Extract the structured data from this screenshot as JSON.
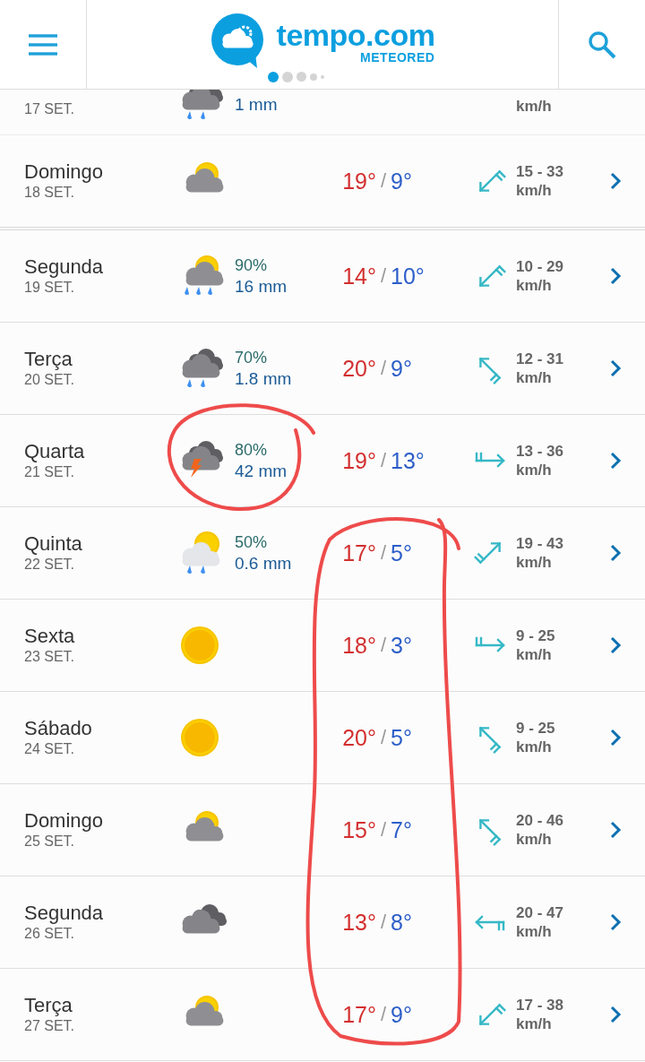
{
  "header": {
    "brand": "tempo.com",
    "sub_brand": "METEORED",
    "pager": [
      {
        "selected": true
      },
      {
        "selected": false
      },
      {
        "selected": false
      },
      {
        "selected": false
      },
      {
        "selected": false
      }
    ]
  },
  "partial_row": {
    "date": "17 SET.",
    "sky": {
      "kind": "cloudy-rain"
    },
    "precip_amount": "1 mm",
    "wind_unit": "km/h"
  },
  "days": [
    {
      "day": "Domingo",
      "date": "18 SET.",
      "sky": {
        "kind": "partly-cloudy"
      },
      "max": "19°",
      "separator": "/",
      "min": "9°",
      "wind_arrow": {
        "kind": "northeast"
      },
      "wind": "15 - 33",
      "wind_unit": "km/h"
    },
    {
      "day": "Segunda",
      "date": "19 SET.",
      "sky": {
        "kind": "partly-cloudy-rain"
      },
      "precip_chance": "90%",
      "precip_amount": "16 mm",
      "max": "14°",
      "separator": "/",
      "min": "10°",
      "wind_arrow": {
        "kind": "northeast"
      },
      "wind": "10 - 29",
      "wind_unit": "km/h"
    },
    {
      "day": "Terça",
      "date": "20 SET.",
      "sky": {
        "kind": "cloudy-rain"
      },
      "precip_chance": "70%",
      "precip_amount": "1.8 mm",
      "max": "20°",
      "separator": "/",
      "min": "9°",
      "wind_arrow": {
        "kind": "southeast"
      },
      "wind": "12 - 31",
      "wind_unit": "km/h"
    },
    {
      "day": "Quarta",
      "date": "21 SET.",
      "sky": {
        "kind": "storm"
      },
      "precip_chance": "80%",
      "precip_amount": "42 mm",
      "max": "19°",
      "separator": "/",
      "min": "13°",
      "wind_arrow": {
        "kind": "west"
      },
      "wind": "13 - 36",
      "wind_unit": "km/h"
    },
    {
      "day": "Quinta",
      "date": "22 SET.",
      "sky": {
        "kind": "sunny-showers"
      },
      "precip_chance": "50%",
      "precip_amount": "0.6 mm",
      "max": "17°",
      "separator": "/",
      "min": "5°",
      "wind_arrow": {
        "kind": "southwest"
      },
      "wind": "19 - 43",
      "wind_unit": "km/h"
    },
    {
      "day": "Sexta",
      "date": "23 SET.",
      "sky": {
        "kind": "sunny"
      },
      "max": "18°",
      "separator": "/",
      "min": "3°",
      "wind_arrow": {
        "kind": "west"
      },
      "wind": "9 - 25",
      "wind_unit": "km/h"
    },
    {
      "day": "Sábado",
      "date": "24 SET.",
      "sky": {
        "kind": "sunny"
      },
      "max": "20°",
      "separator": "/",
      "min": "5°",
      "wind_arrow": {
        "kind": "southeast"
      },
      "wind": "9 - 25",
      "wind_unit": "km/h"
    },
    {
      "day": "Domingo",
      "date": "25 SET.",
      "sky": {
        "kind": "partly-cloudy"
      },
      "max": "15°",
      "separator": "/",
      "min": "7°",
      "wind_arrow": {
        "kind": "southeast"
      },
      "wind": "20 - 46",
      "wind_unit": "km/h"
    },
    {
      "day": "Segunda",
      "date": "26 SET.",
      "sky": {
        "kind": "overcast"
      },
      "max": "13°",
      "separator": "/",
      "min": "8°",
      "wind_arrow": {
        "kind": "east"
      },
      "wind": "20 - 47",
      "wind_unit": "km/h"
    },
    {
      "day": "Terça",
      "date": "27 SET.",
      "sky": {
        "kind": "partly-cloudy"
      },
      "max": "17°",
      "separator": "/",
      "min": "9°",
      "wind_arrow": {
        "kind": "northeast"
      },
      "wind": "17 - 38",
      "wind_unit": "km/h"
    }
  ]
}
